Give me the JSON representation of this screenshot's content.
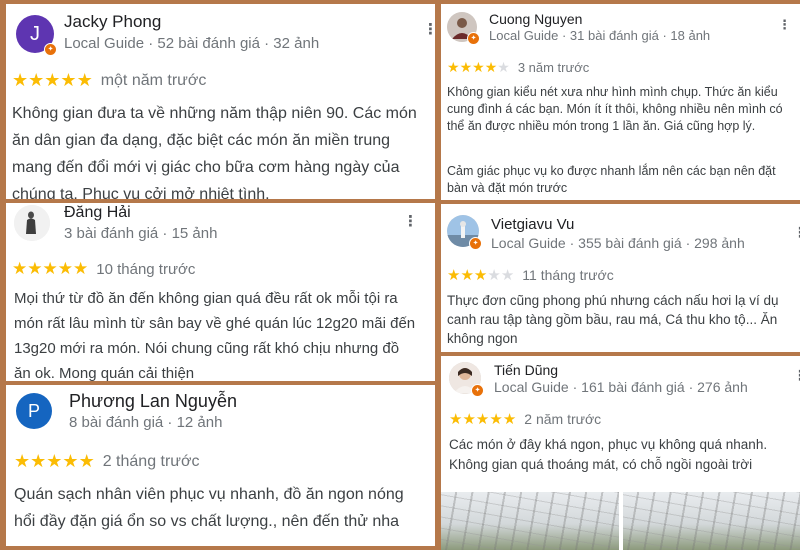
{
  "reviews": [
    {
      "avatar_letter": "J",
      "avatar_color": "#5e35b1",
      "name": "Jacky Phong",
      "meta": "Local Guide · 52 bài đánh giá · 32 ảnh",
      "rating": 5,
      "time": "một năm trước",
      "text": "Không gian đưa ta về những năm thập niên 90. Các món ăn dân gian đa dạng, đặc biệt các món ăn miền trung mang đến đổi mới vị giác cho bữa cơm hàng ngày của chúng ta. Phục vụ cởi mở nhiệt tình."
    },
    {
      "avatar_letter": "",
      "name": "Đăng Hải",
      "meta": "3 bài đánh giá · 15 ảnh",
      "rating": 5,
      "time": "10 tháng trước",
      "text": "Mọi thứ từ đồ ăn đến không gian quá đều rất ok mỗi tội ra món rất lâu mình từ sân bay về ghé quán lúc 12g20 mãi đến 13g20 mới ra món. Nói chung cũng rất khó chịu nhưng đồ ăn ok. Mong quán cải thiện"
    },
    {
      "avatar_letter": "P",
      "avatar_color": "#1565c0",
      "name": "Phương Lan Nguyễn",
      "meta": "8 bài đánh giá · 12 ảnh",
      "rating": 5,
      "time": "2 tháng trước",
      "text": "Quán sạch nhân viên phục vụ nhanh, đồ ăn ngon nóng hổi đầy đặn giá ổn so vs chất lượng., nên đến thử nha"
    },
    {
      "avatar_letter": "",
      "name": "Cuong Nguyen",
      "meta": "Local Guide · 31 bài đánh giá · 18 ảnh",
      "rating": 4,
      "time": "3 năm trước",
      "text": "Không gian kiểu nét xưa như hình mình chụp. Thức ăn kiểu cung đình á các bạn. Món ít ít thôi, không nhiều nên mình có thể ăn được nhiều món trong 1 lần ăn. Giá cũng hợp lý.",
      "text2": "Cảm giác phục vụ ko được nhanh lắm nên các bạn nên đặt bàn và đặt món trước"
    },
    {
      "avatar_letter": "",
      "name": "Vietgiavu Vu",
      "meta": "Local Guide · 355 bài đánh giá · 298 ảnh",
      "rating": 3,
      "time": "11 tháng trước",
      "text": "Thực đơn cũng phong phú nhưng cách nấu hơi lạ ví dụ canh rau tập tàng gồm bầu, rau má, Cá thu kho tộ... Ăn không ngon"
    },
    {
      "avatar_letter": "",
      "name": "Tiến Dũng",
      "meta": "Local Guide · 161 bài đánh giá · 276 ảnh",
      "rating": 5,
      "time": "2 năm trước",
      "text": "Các món ở đây khá ngon, phục vụ không quá nhanh. Không gian quá thoáng mát, có chỗ ngồi ngoài trời"
    }
  ]
}
